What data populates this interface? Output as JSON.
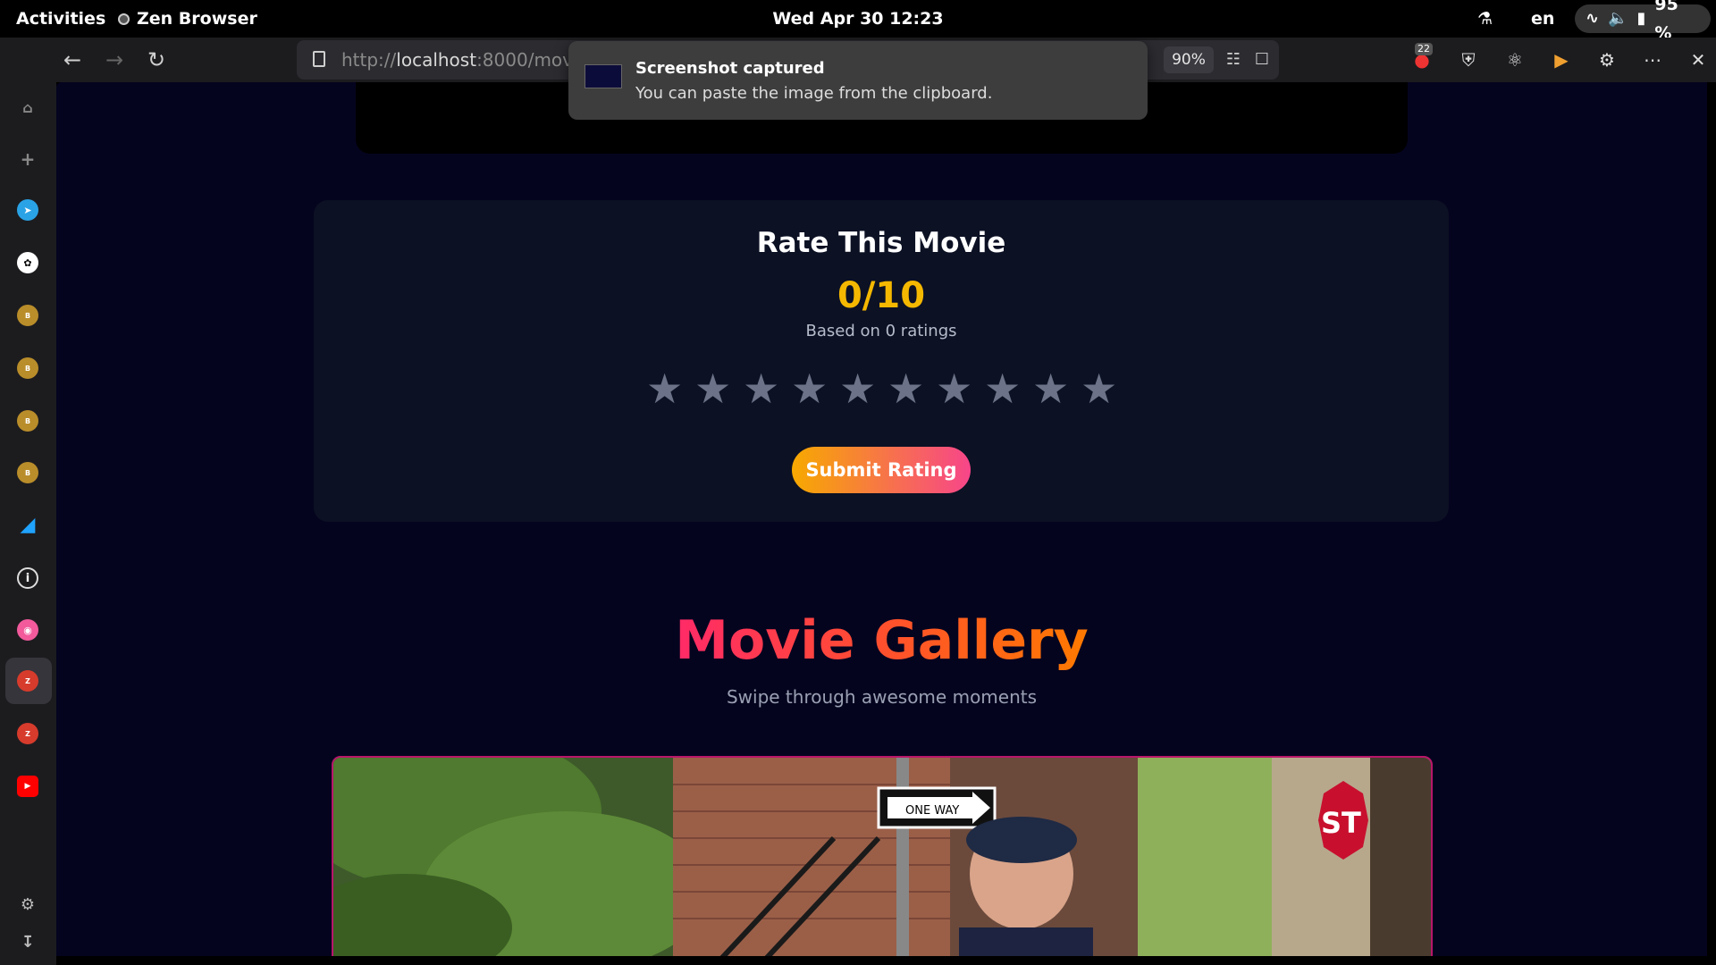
{
  "topbar": {
    "activities": "Activities",
    "app_name": "Zen Browser",
    "clock": "Wed Apr 30  12:23",
    "language": "en",
    "battery": "95 %"
  },
  "browser": {
    "url_prefix": "http://",
    "url_host": "localhost",
    "url_rest": ":8000/movie",
    "zoom": "90%",
    "ublock_badge": "22"
  },
  "notification": {
    "title": "Screenshot captured",
    "body": "You can paste the image from the clipboard."
  },
  "rating": {
    "title": "Rate This Movie",
    "score": "0/10",
    "count_text": "Based on 0 ratings",
    "stars_total": 10,
    "stars_filled": 0,
    "submit_label": "Submit Rating"
  },
  "gallery": {
    "title": "Movie Gallery",
    "subtitle": "Swipe through awesome moments",
    "street_sign": "ONE WAY",
    "stop_sign": "ST"
  },
  "colors": {
    "page_bg": "#05041f",
    "card_bg": "#0c1124",
    "score": "#f5b800",
    "star_empty": "#6c7388",
    "button_from": "#f7a900",
    "button_to": "#f7458a",
    "gallery_border": "#b8166a"
  },
  "sidebar": {
    "icons": [
      "home-icon",
      "new-tab-icon",
      "telegram-icon",
      "chatgpt-icon",
      "bhu-icon",
      "bhu-icon",
      "bhu-icon",
      "bhu-icon",
      "k-app-icon",
      "info-icon",
      "ghost-app-icon",
      "zma-icon",
      "zma-icon",
      "youtube-icon",
      "settings-icon",
      "downloads-icon"
    ]
  }
}
